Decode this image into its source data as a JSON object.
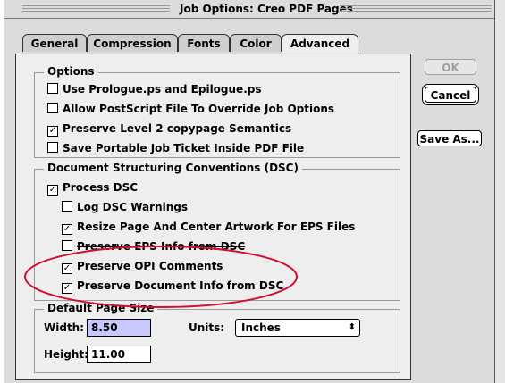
{
  "window": {
    "title": "Job Options: Creo PDF Pages"
  },
  "tabs": [
    {
      "label": "General",
      "active": false
    },
    {
      "label": "Compression",
      "active": false
    },
    {
      "label": "Fonts",
      "active": false
    },
    {
      "label": "Color",
      "active": false
    },
    {
      "label": "Advanced",
      "active": true
    }
  ],
  "options": {
    "title": "Options",
    "items": [
      {
        "label": "Use Prologue.ps and Epilogue.ps",
        "checked": false
      },
      {
        "label": "Allow PostScript File To Override Job Options",
        "checked": false
      },
      {
        "label": "Preserve Level 2 copypage Semantics",
        "checked": true
      },
      {
        "label": "Save Portable Job Ticket Inside PDF File",
        "checked": false
      }
    ]
  },
  "dsc": {
    "title": "Document Structuring Conventions (DSC)",
    "process": {
      "label": "Process DSC",
      "checked": true
    },
    "items": [
      {
        "label": "Log DSC Warnings",
        "checked": false
      },
      {
        "label": "Resize Page And Center Artwork For EPS Files",
        "checked": true
      },
      {
        "label": "Preserve EPS Info from DSC",
        "checked": false
      },
      {
        "label": "Preserve OPI Comments",
        "checked": true
      },
      {
        "label": "Preserve Document Info from DSC",
        "checked": true
      }
    ]
  },
  "page_size": {
    "title": "Default Page Size",
    "width_label": "Width:",
    "width_value": "8.50",
    "height_label": "Height:",
    "height_value": "11.00",
    "units_label": "Units:",
    "units_value": "Inches"
  },
  "buttons": {
    "ok": "OK",
    "cancel": "Cancel",
    "save_as": "Save As..."
  },
  "highlight_color": "#d01030"
}
